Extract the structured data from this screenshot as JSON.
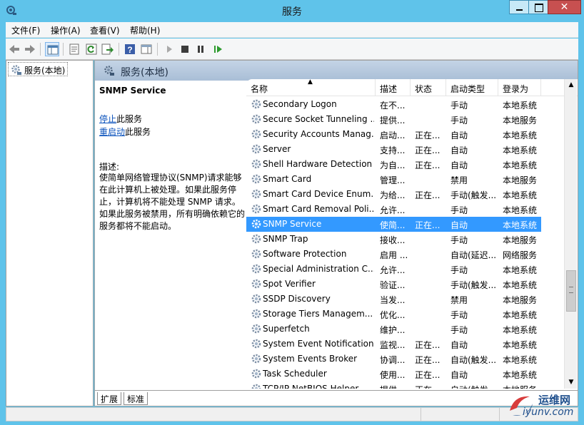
{
  "window": {
    "title": "服务"
  },
  "menu": [
    {
      "label": "文件(F)"
    },
    {
      "label": "操作(A)"
    },
    {
      "label": "查看(V)"
    },
    {
      "label": "帮助(H)"
    }
  ],
  "tree": {
    "root_label": "服务(本地)"
  },
  "panel": {
    "header": "服务(本地)"
  },
  "detail": {
    "service_name": "SNMP Service",
    "stop_link": "停止",
    "stop_suffix": "此服务",
    "restart_link": "重启动",
    "restart_suffix": "此服务",
    "desc_label": "描述:",
    "desc_text": "使简单网络管理协议(SNMP)请求能够在此计算机上被处理。如果此服务停止，计算机将不能处理 SNMP 请求。如果此服务被禁用，所有明确依赖它的服务都将不能启动。"
  },
  "columns": {
    "name": "名称",
    "desc": "描述",
    "status": "状态",
    "startup": "启动类型",
    "logon": "登录为"
  },
  "services": [
    {
      "name": "Secondary Logon",
      "desc": "在不...",
      "status": "",
      "startup": "手动",
      "logon": "本地系统"
    },
    {
      "name": "Secure Socket Tunneling ...",
      "desc": "提供...",
      "status": "",
      "startup": "手动",
      "logon": "本地服务"
    },
    {
      "name": "Security Accounts Manag...",
      "desc": "启动...",
      "status": "正在...",
      "startup": "自动",
      "logon": "本地系统"
    },
    {
      "name": "Server",
      "desc": "支持...",
      "status": "正在...",
      "startup": "自动",
      "logon": "本地系统"
    },
    {
      "name": "Shell Hardware Detection",
      "desc": "为自...",
      "status": "正在...",
      "startup": "自动",
      "logon": "本地系统"
    },
    {
      "name": "Smart Card",
      "desc": "管理...",
      "status": "",
      "startup": "禁用",
      "logon": "本地服务"
    },
    {
      "name": "Smart Card Device Enum...",
      "desc": "为给...",
      "status": "正在...",
      "startup": "手动(触发...",
      "logon": "本地系统"
    },
    {
      "name": "Smart Card Removal Poli...",
      "desc": "允许...",
      "status": "",
      "startup": "手动",
      "logon": "本地系统"
    },
    {
      "name": "SNMP Service",
      "desc": "使简...",
      "status": "正在...",
      "startup": "自动",
      "logon": "本地系统",
      "selected": true
    },
    {
      "name": "SNMP Trap",
      "desc": "接收...",
      "status": "",
      "startup": "手动",
      "logon": "本地服务"
    },
    {
      "name": "Software Protection",
      "desc": "启用 ...",
      "status": "",
      "startup": "自动(延迟...",
      "logon": "网络服务"
    },
    {
      "name": "Special Administration C...",
      "desc": "允许...",
      "status": "",
      "startup": "手动",
      "logon": "本地系统"
    },
    {
      "name": "Spot Verifier",
      "desc": "验证...",
      "status": "",
      "startup": "手动(触发...",
      "logon": "本地系统"
    },
    {
      "name": "SSDP Discovery",
      "desc": "当发...",
      "status": "",
      "startup": "禁用",
      "logon": "本地服务"
    },
    {
      "name": "Storage Tiers Managem...",
      "desc": "优化...",
      "status": "",
      "startup": "手动",
      "logon": "本地系统"
    },
    {
      "name": "Superfetch",
      "desc": "维护...",
      "status": "",
      "startup": "手动",
      "logon": "本地系统"
    },
    {
      "name": "System Event Notification...",
      "desc": "监视...",
      "status": "正在...",
      "startup": "自动",
      "logon": "本地系统"
    },
    {
      "name": "System Events Broker",
      "desc": "协调...",
      "status": "正在...",
      "startup": "自动(触发...",
      "logon": "本地系统"
    },
    {
      "name": "Task Scheduler",
      "desc": "使用...",
      "status": "正在...",
      "startup": "自动",
      "logon": "本地系统"
    },
    {
      "name": "TCP/IP NetBIOS Helper",
      "desc": "提供...",
      "status": "正在...",
      "startup": "自动(触发...",
      "logon": "本地服务"
    }
  ],
  "tabs": [
    {
      "label": "扩展"
    },
    {
      "label": "标准"
    }
  ],
  "watermark": {
    "brand": "运维网",
    "url": "iyunv.com"
  },
  "colors": {
    "titlebar": "#5fc3ea",
    "selection": "#3399ff",
    "link": "#0a52bc",
    "close": "#c75050"
  },
  "icons": [
    "services-app-icon",
    "back-arrow-icon",
    "forward-arrow-icon",
    "show-console-tree-icon",
    "properties-icon",
    "refresh-icon",
    "export-list-icon",
    "help-icon",
    "action-pane-icon",
    "start-service-icon",
    "stop-service-icon",
    "pause-service-icon",
    "restart-service-icon",
    "gear-icon"
  ]
}
